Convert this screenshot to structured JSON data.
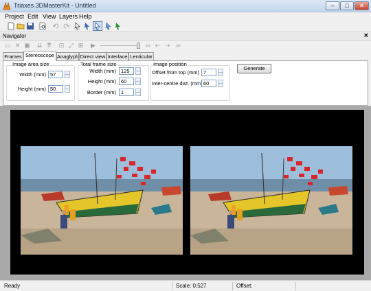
{
  "window": {
    "title": "Triaxes 3DMasterKit - Untitled"
  },
  "menu": [
    "Project",
    "Edit",
    "View",
    "Layers",
    "Help"
  ],
  "navigator": {
    "title": "Navigator"
  },
  "tabs": [
    "Frames",
    "Stereoscope",
    "Anaglyph",
    "Direct view",
    "Interlace",
    "Lenticular"
  ],
  "selected_tab": "Stereoscope",
  "image_area": {
    "title": "Image area size",
    "width_label": "Width  (mm)",
    "width": "57",
    "height_label": "Height  (mm)",
    "height": "50"
  },
  "total_frame": {
    "title": "Total frame size",
    "width_label": "Width (mm)",
    "width": "125",
    "height_label": "Height (mm)",
    "height": "60",
    "border_label": "Border (mm)",
    "border": "1"
  },
  "image_position": {
    "title": "Image position",
    "offset_label": "Offset from top (mm)",
    "offset": "7",
    "intercentre_label": "Inter-centre dist. (mm)",
    "intercentre": "60"
  },
  "generate_label": "Generate",
  "status": {
    "ready": "Ready",
    "scale": "Scale: 0,527",
    "offset": "Offset:"
  },
  "colors": {
    "accent": "#3e6aa8",
    "canvas": "#000000",
    "viewport_bg": "#a9a9a9"
  }
}
